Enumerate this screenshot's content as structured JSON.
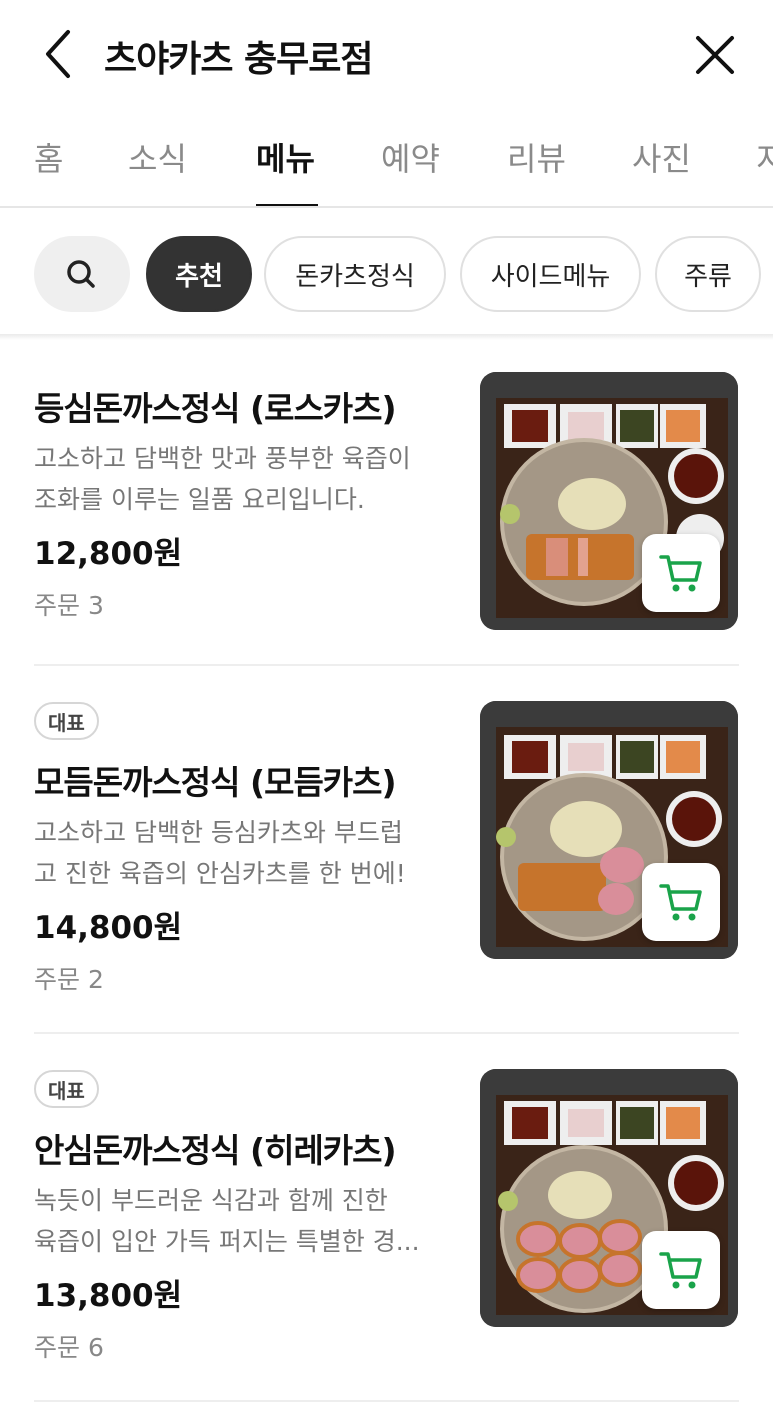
{
  "header": {
    "title": "츠야카츠 충무로점",
    "back_icon": "chevron-left-icon",
    "close_icon": "close-icon"
  },
  "tabs": [
    {
      "label": "홈"
    },
    {
      "label": "소식"
    },
    {
      "label": "메뉴",
      "active": true
    },
    {
      "label": "예약"
    },
    {
      "label": "리뷰"
    },
    {
      "label": "사진"
    },
    {
      "label": "지"
    }
  ],
  "filters": {
    "search_icon": "search-icon",
    "chips": [
      {
        "label": "추천",
        "active": true
      },
      {
        "label": "돈카츠정식"
      },
      {
        "label": "사이드메뉴"
      },
      {
        "label": "주류"
      }
    ]
  },
  "colors": {
    "accent_green": "#1aa34a",
    "active_chip": "#333333"
  },
  "menu": [
    {
      "badge": "",
      "name": "등심돈까스정식 (로스카츠)",
      "desc1": "고소하고 담백한 맛과 풍부한 육즙이",
      "desc2": "조화를 이루는 일품 요리입니다.",
      "price": "12,800원",
      "orders": "주문 3"
    },
    {
      "badge": "대표",
      "name": "모듬돈까스정식 (모듬카츠)",
      "desc1": "고소하고 담백한 등심카츠와 부드럽",
      "desc2": "고 진한 육즙의 안심카츠를 한 번에!",
      "price": "14,800원",
      "orders": "주문 2"
    },
    {
      "badge": "대표",
      "name": "안심돈까스정식 (히레카츠)",
      "desc1": "녹듯이 부드러운 식감과 함께 진한",
      "desc2": "육즙이 입안 가득 퍼지는 특별한 경...",
      "price": "13,800원",
      "orders": "주문 6"
    }
  ]
}
